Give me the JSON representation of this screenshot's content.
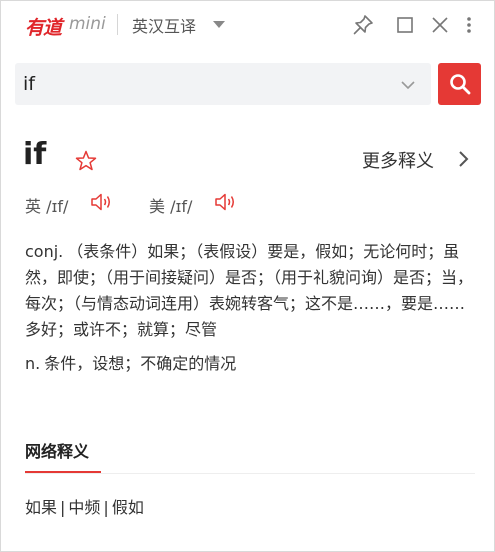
{
  "app": {
    "logo_text": "有道",
    "logo_sub": "mini",
    "mode_label": "英汉互译"
  },
  "search": {
    "value": "if"
  },
  "entry": {
    "word": "if",
    "more_label": "更多释义",
    "uk_label": "英 /ɪf/",
    "us_label": "美 /ɪf/",
    "definitions": [
      {
        "pos": "conj.",
        "text": "（表条件）如果；（表假设）要是，假如；无论何时；虽然，即使；（用于间接疑问）是否；（用于礼貌问询）是否；当，每次；（与情态动词连用）表婉转客气；这不是……，要是……多好；或许不；就算；尽管"
      },
      {
        "pos": "n.",
        "text": "条件，设想；不确定的情况"
      }
    ]
  },
  "web": {
    "title": "网络释义",
    "items": [
      "如果",
      "中频",
      "假如"
    ]
  },
  "colors": {
    "accent": "#e53935",
    "logo": "#e0262b"
  },
  "icons": [
    "pin-icon",
    "maximize-icon",
    "close-icon",
    "more-vertical-icon",
    "chevron-down-icon",
    "search-icon",
    "star-icon",
    "chevron-right-icon",
    "speaker-icon"
  ]
}
